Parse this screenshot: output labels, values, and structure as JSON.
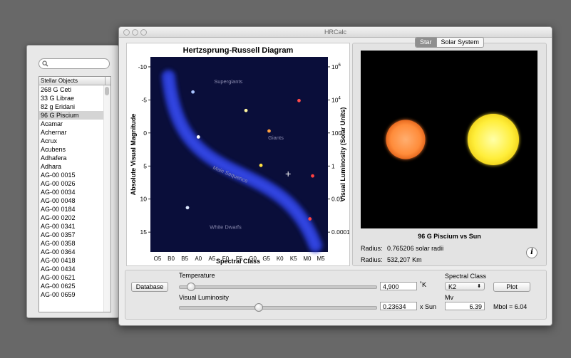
{
  "window": {
    "title": "HRCalc"
  },
  "sidebar": {
    "list_header": "Stellar Objects",
    "items": [
      "268 G Ceti",
      "33 G Librae",
      "82 g Eridani",
      "96 G Piscium",
      "Acamar",
      "Achernar",
      "Acrux",
      "Acubens",
      "Adhafera",
      "Adhara",
      "AG-00 0015",
      "AG-00 0026",
      "AG-00 0034",
      "AG-00 0048",
      "AG-00 0184",
      "AG-00 0202",
      "AG-00 0341",
      "AG-00 0357",
      "AG-00 0358",
      "AG-00 0364",
      "AG-00 0418",
      "AG-00 0434",
      "AG-00 0621",
      "AG-00 0625",
      "AG-00 0659"
    ],
    "selected_index": 3
  },
  "chart_data": {
    "type": "scatter",
    "title": "Hertzsprung-Russell Diagram",
    "xlabel": "Spectral Class",
    "ylabel": "Absolute Visual Magnitude",
    "y2label": "Visual Luminosity (Solar Units)",
    "x_categories": [
      "O5",
      "B0",
      "B5",
      "A0",
      "A5",
      "F0",
      "F5",
      "G0",
      "G5",
      "K0",
      "K5",
      "M0",
      "M5"
    ],
    "yticks": [
      -10,
      -5,
      0,
      5,
      10,
      15
    ],
    "ylim": [
      -11.5,
      18
    ],
    "y2ticks": [
      {
        "base": "10",
        "exp": "6",
        "mag": -10
      },
      {
        "base": "10",
        "exp": "4",
        "mag": -5
      },
      {
        "base": "100",
        "exp": "",
        "mag": 0
      },
      {
        "base": "1",
        "exp": "",
        "mag": 5
      },
      {
        "base": "0.01",
        "exp": "",
        "mag": 10
      },
      {
        "base": "0.0001",
        "exp": "",
        "mag": 15
      }
    ],
    "regions": [
      {
        "label": "Supergiants",
        "x": 5.2,
        "y": -7.5
      },
      {
        "label": "Giants",
        "x": 8.7,
        "y": 1.0
      },
      {
        "label": "Main Sequence",
        "x": 5.3,
        "y": 6.5,
        "rotate": 22
      },
      {
        "label": "White Dwarfs",
        "x": 5.0,
        "y": 14.5
      }
    ],
    "stars": [
      {
        "x": 2.6,
        "y": -6.2,
        "color": "#a9c4ff"
      },
      {
        "x": 3.0,
        "y": 0.6,
        "color": "#ffffff"
      },
      {
        "x": 6.5,
        "y": -3.4,
        "color": "#fff6a0"
      },
      {
        "x": 10.4,
        "y": -4.9,
        "color": "#ff4a4a"
      },
      {
        "x": 8.2,
        "y": -0.3,
        "color": "#ffa040"
      },
      {
        "x": 7.6,
        "y": 4.9,
        "color": "#ffe040"
      },
      {
        "x": 11.4,
        "y": 6.5,
        "color": "#ff4040"
      },
      {
        "x": 2.2,
        "y": 11.3,
        "color": "#dde8ff"
      },
      {
        "x": 11.2,
        "y": 13.0,
        "color": "#ff4444"
      }
    ],
    "marker": {
      "x": 9.6,
      "y": 6.2
    }
  },
  "star_view": {
    "tabs": [
      "Star",
      "Solar System"
    ],
    "active_tab": "Star",
    "star_color": "#ff8c3a",
    "sun_color": "#ffee3a",
    "star_radius_solar": 0.765206,
    "compare_title": "96 G Piscium vs Sun",
    "radius_label": "Radius:",
    "radius_solar": "0.765206 solar radii",
    "radius_km": "532,207 Km",
    "info_label": "i"
  },
  "controls": {
    "database_button": "Database",
    "temperature_label": "Temperature",
    "temperature_value": "4,900",
    "temperature_unit": "˚K",
    "temperature_slider_fraction": 0.04,
    "luminosity_label": "Visual Luminosity",
    "luminosity_value": "0.23634",
    "luminosity_unit": "x Sun",
    "luminosity_slider_fraction": 0.4,
    "spectral_class_label": "Spectral Class",
    "spectral_class_value": "K2",
    "plot_button": "Plot",
    "mv_label": "Mv",
    "mv_value": "6.39",
    "mbol": "Mbol = 6.04"
  }
}
